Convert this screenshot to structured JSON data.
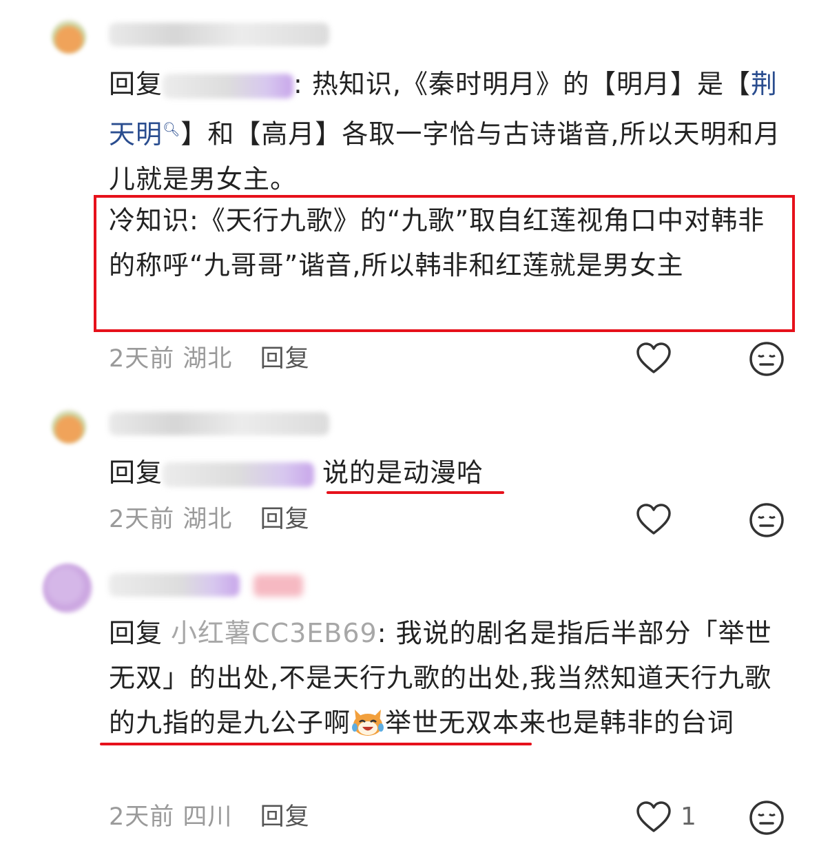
{
  "comments": [
    {
      "reply_prefix": "回复",
      "reply_colon": ": ",
      "text_part1": "热知识,《秦时明月》的【明月】是【",
      "topic_link": "荆天明",
      "text_part2": "】和【高月】各取一字恰与古诗谐音,所以天明和月儿就是男女主。",
      "highlighted_text": "冷知识:《天行九歌》的“九歌”取自红莲视角口中对韩非的称呼“九哥哥”谐音,所以韩非和红莲就是男女主",
      "time": "2天前",
      "location": "湖北",
      "reply_label": "回复"
    },
    {
      "reply_prefix": "回复",
      "text": "说的是动漫哈",
      "time": "2天前",
      "location": "湖北",
      "reply_label": "回复"
    },
    {
      "reply_prefix": "回复",
      "mention": "小红薯CC3EB69",
      "text_part1": ": 我说的剧名是指后半部分「举世无双」的出处,不是天行九歌的出处,我当然知道",
      "underlined_text": "天行九歌的九指的是九公子啊",
      "text_part2": "举世无双本来也是韩非的台词",
      "time": "2天前",
      "location": "四川",
      "reply_label": "回复",
      "like_count": "1"
    }
  ],
  "colors": {
    "annotation_red": "#e6111b",
    "mention_gray": "#a7a7a7",
    "topic_blue": "#2a4d8f",
    "meta_gray": "#9a9a9a"
  },
  "icons": [
    "heart-icon",
    "sad-face-icon",
    "search-icon",
    "laughing-cat-emoji"
  ]
}
